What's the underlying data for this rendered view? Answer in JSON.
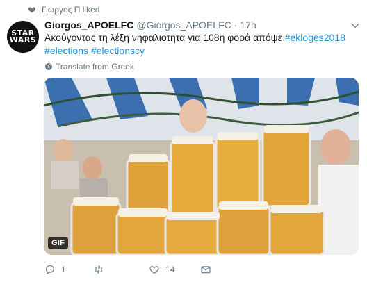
{
  "liked": {
    "text": "Γιωργος Π liked"
  },
  "avatar": {
    "logo_text": "STAR WARS"
  },
  "tweet": {
    "display_name": "Giorgos_APOELFC",
    "handle": "@Giorgos_APOELFC",
    "separator": "·",
    "time": "17h",
    "text_plain": "Ακούγοντας τη λέξη νηφαλιοτητα για 108η φορά απόψε ",
    "hashtags": [
      "#ekloges2018",
      "#elections",
      "#electionscy"
    ]
  },
  "translate": {
    "label": "Translate from Greek"
  },
  "media": {
    "badge": "GIF"
  },
  "actions": {
    "reply_count": "1",
    "retweet_count": "",
    "like_count": "14"
  },
  "colors": {
    "link": "#1b95e0",
    "secondary": "#657786",
    "text": "#14171a"
  },
  "icons": [
    "heart-icon",
    "chevron-down-icon",
    "globe-icon",
    "reply-icon",
    "retweet-icon",
    "like-icon",
    "message-icon"
  ]
}
